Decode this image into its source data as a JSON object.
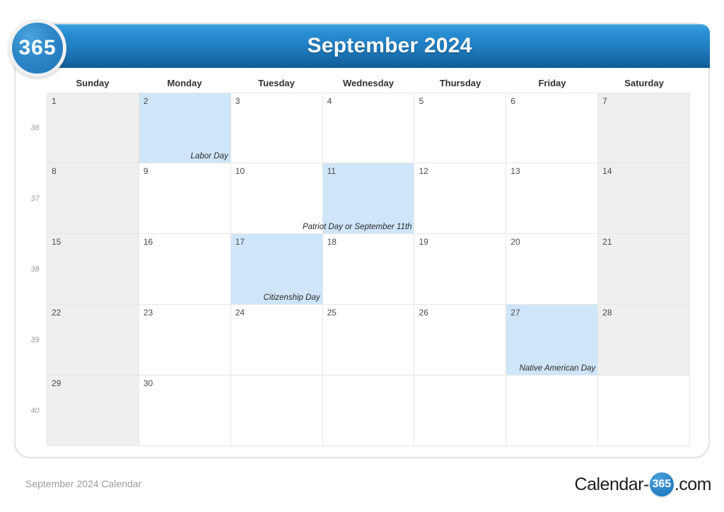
{
  "brand": {
    "badge_text": "365",
    "logo_prefix": "Calendar-",
    "logo_circle": "365",
    "logo_suffix": ".com"
  },
  "header": {
    "title": "September 2024"
  },
  "watermark": {
    "text": "365"
  },
  "weekdays": [
    "Sunday",
    "Monday",
    "Tuesday",
    "Wednesday",
    "Thursday",
    "Friday",
    "Saturday"
  ],
  "colors": {
    "header_blue": "#1f7cc0",
    "holiday_fill": "#cfe5f9",
    "weekend_fill": "#efefef",
    "grid_line": "#e6e6e6",
    "badge_blue": "#2e87c8"
  },
  "weeks": [
    {
      "week_number": "36",
      "days": [
        {
          "num": "1",
          "event": "",
          "weekend": true,
          "holiday": false
        },
        {
          "num": "2",
          "event": "Labor Day",
          "weekend": false,
          "holiday": true
        },
        {
          "num": "3",
          "event": "",
          "weekend": false,
          "holiday": false
        },
        {
          "num": "4",
          "event": "",
          "weekend": false,
          "holiday": false
        },
        {
          "num": "5",
          "event": "",
          "weekend": false,
          "holiday": false
        },
        {
          "num": "6",
          "event": "",
          "weekend": false,
          "holiday": false
        },
        {
          "num": "7",
          "event": "",
          "weekend": true,
          "holiday": false
        }
      ]
    },
    {
      "week_number": "37",
      "days": [
        {
          "num": "8",
          "event": "",
          "weekend": true,
          "holiday": false
        },
        {
          "num": "9",
          "event": "",
          "weekend": false,
          "holiday": false
        },
        {
          "num": "10",
          "event": "",
          "weekend": false,
          "holiday": false
        },
        {
          "num": "11",
          "event": "Patriot Day or September 11th",
          "weekend": false,
          "holiday": true
        },
        {
          "num": "12",
          "event": "",
          "weekend": false,
          "holiday": false
        },
        {
          "num": "13",
          "event": "",
          "weekend": false,
          "holiday": false
        },
        {
          "num": "14",
          "event": "",
          "weekend": true,
          "holiday": false
        }
      ]
    },
    {
      "week_number": "38",
      "days": [
        {
          "num": "15",
          "event": "",
          "weekend": true,
          "holiday": false
        },
        {
          "num": "16",
          "event": "",
          "weekend": false,
          "holiday": false
        },
        {
          "num": "17",
          "event": "Citizenship Day",
          "weekend": false,
          "holiday": true
        },
        {
          "num": "18",
          "event": "",
          "weekend": false,
          "holiday": false
        },
        {
          "num": "19",
          "event": "",
          "weekend": false,
          "holiday": false
        },
        {
          "num": "20",
          "event": "",
          "weekend": false,
          "holiday": false
        },
        {
          "num": "21",
          "event": "",
          "weekend": true,
          "holiday": false
        }
      ]
    },
    {
      "week_number": "39",
      "days": [
        {
          "num": "22",
          "event": "",
          "weekend": true,
          "holiday": false
        },
        {
          "num": "23",
          "event": "",
          "weekend": false,
          "holiday": false
        },
        {
          "num": "24",
          "event": "",
          "weekend": false,
          "holiday": false
        },
        {
          "num": "25",
          "event": "",
          "weekend": false,
          "holiday": false
        },
        {
          "num": "26",
          "event": "",
          "weekend": false,
          "holiday": false
        },
        {
          "num": "27",
          "event": "Native American Day",
          "weekend": false,
          "holiday": true
        },
        {
          "num": "28",
          "event": "",
          "weekend": true,
          "holiday": false
        }
      ]
    },
    {
      "week_number": "40",
      "days": [
        {
          "num": "29",
          "event": "",
          "weekend": true,
          "holiday": false
        },
        {
          "num": "30",
          "event": "",
          "weekend": false,
          "holiday": false
        },
        {
          "num": "",
          "event": "",
          "weekend": false,
          "holiday": false
        },
        {
          "num": "",
          "event": "",
          "weekend": false,
          "holiday": false
        },
        {
          "num": "",
          "event": "",
          "weekend": false,
          "holiday": false
        },
        {
          "num": "",
          "event": "",
          "weekend": false,
          "holiday": false
        },
        {
          "num": "",
          "event": "",
          "weekend": false,
          "holiday": false
        }
      ]
    }
  ],
  "footer": {
    "caption": "September 2024 Calendar"
  }
}
